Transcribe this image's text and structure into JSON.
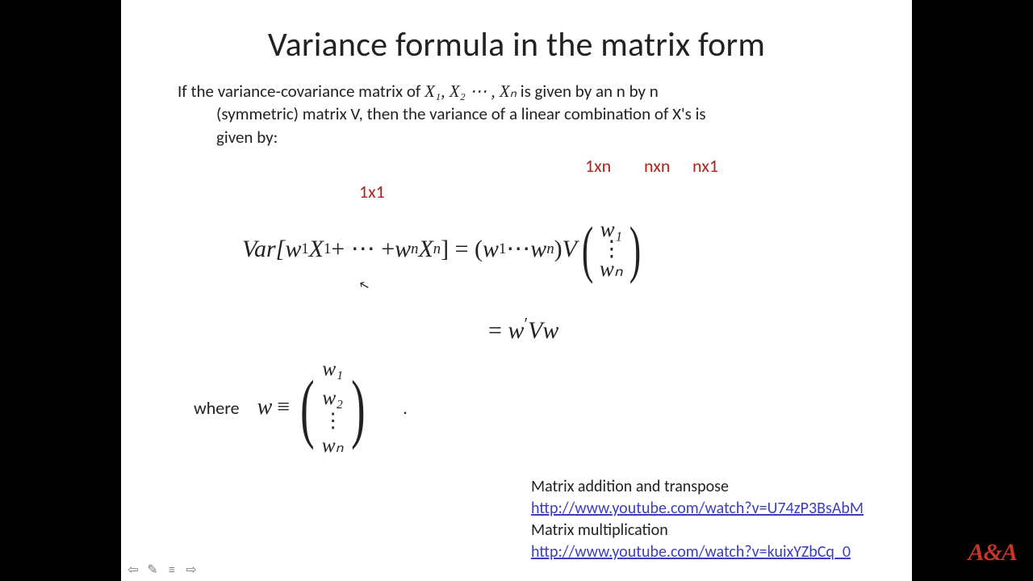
{
  "title": "Variance formula in the matrix form",
  "body": {
    "line1_pre": "If the variance-covariance matrix of ",
    "line1_math": "X₁, X₂ ⋯ , Xₙ",
    "line1_post": " is given by an n by n",
    "line2": "(symmetric) matrix V, then the variance of a linear combination of X's is",
    "line3": "given by:"
  },
  "red_labels": {
    "r1": "1x1",
    "r2": "1xn",
    "r3": "nxn",
    "r4": "nx1"
  },
  "eq1": {
    "var_open": "Var[",
    "w": "w",
    "X": "X",
    "s1": "1",
    "plus": " + ⋯ + ",
    "sn": "n",
    "close_eq": "] = (",
    "dots": " ⋯ ",
    "close_paren": ")",
    "V": "V",
    "col_top": "w₁",
    "col_mid": "⋮",
    "col_bot": "wₙ"
  },
  "eq2": {
    "eq": "= ",
    "w": "w",
    "prime": "′",
    "V": "V"
  },
  "where": {
    "label": "where",
    "w": "w",
    "equiv": "≡",
    "r1": "w₁",
    "r2": "w₂",
    "r3": "⋮",
    "r4": "wₙ",
    "period": "."
  },
  "links": {
    "label1": "Matrix addition and transpose",
    "url1": "http://www.youtube.com/watch?v=U74zP3BsAbM",
    "label2": "Matrix multiplication",
    "url2": "http://www.youtube.com/watch?v=kuixYZbCq_0"
  },
  "watermark": "A&A",
  "nav": {
    "prev": "⇦",
    "pen": "✎",
    "menu": "≡",
    "next": "⇨"
  },
  "cursor": "↖"
}
